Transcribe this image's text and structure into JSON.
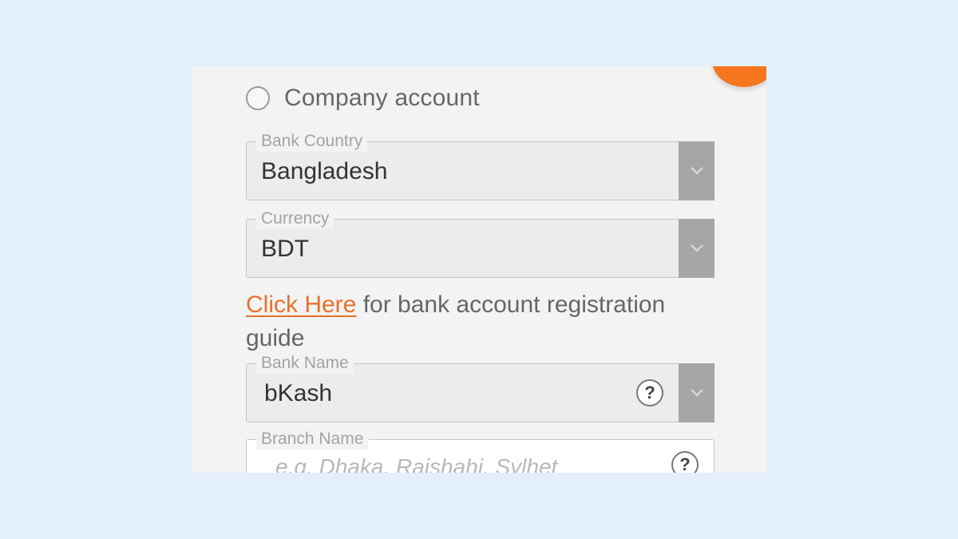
{
  "account_type": {
    "option_label": "Company account"
  },
  "bank_country": {
    "legend": "Bank Country",
    "value": "Bangladesh"
  },
  "currency": {
    "legend": "Currency",
    "value": "BDT"
  },
  "guide": {
    "link_text": "Click Here",
    "text": " for bank account registration guide"
  },
  "bank_name": {
    "legend": "Bank Name",
    "value": "bKash",
    "help_label": "?"
  },
  "branch_name": {
    "legend": "Branch Name",
    "placeholder": "e.g. Dhaka, Rajshahi, Sylhet",
    "help_label": "?"
  },
  "colors": {
    "accent": "#e8702a",
    "orange_button": "#f5761f",
    "dropdown_button": "#a6a6a6",
    "background": "#e3f0fc"
  },
  "icons": {
    "dropdown": "chevron-down-icon",
    "help": "question-mark-icon"
  }
}
